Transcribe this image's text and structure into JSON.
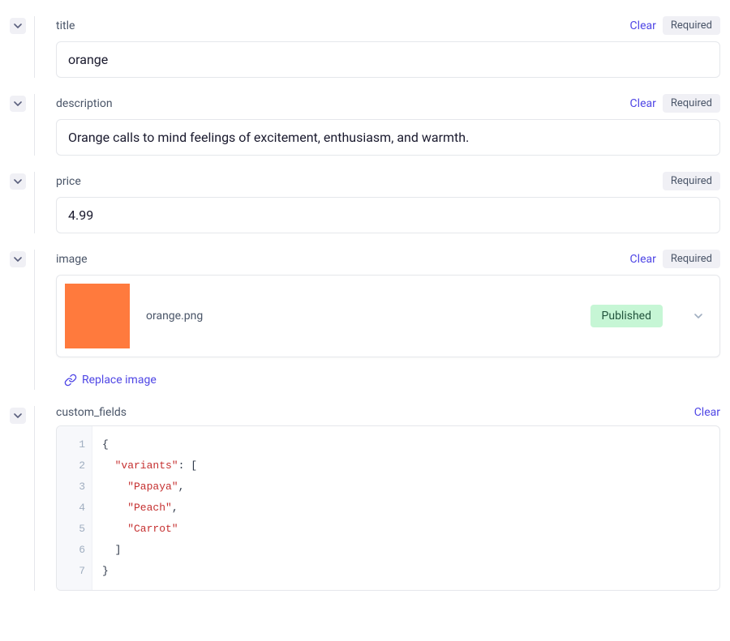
{
  "actions": {
    "clear": "Clear",
    "required": "Required"
  },
  "fields": {
    "title": {
      "label": "title",
      "value": "orange",
      "clearable": true,
      "required": true
    },
    "description": {
      "label": "description",
      "value": "Orange calls to mind feelings of excitement, enthusiasm, and warmth.",
      "clearable": true,
      "required": true
    },
    "price": {
      "label": "price",
      "value": "4.99",
      "clearable": false,
      "required": true
    },
    "image": {
      "label": "image",
      "filename": "orange.png",
      "swatch": "#ff7a3d",
      "status": "Published",
      "replace_label": "Replace image",
      "clearable": true,
      "required": true
    },
    "custom_fields": {
      "label": "custom_fields",
      "clearable": true,
      "required": false,
      "code": {
        "lines": [
          "1",
          "2",
          "3",
          "4",
          "5",
          "6",
          "7"
        ],
        "open_brace": "{",
        "key_variants": "\"variants\"",
        "colon_bracket": ": [",
        "v0": "\"Papaya\"",
        "v1": "\"Peach\"",
        "v2": "\"Carrot\"",
        "comma": ",",
        "close_bracket": "]",
        "close_brace": "}"
      }
    }
  }
}
